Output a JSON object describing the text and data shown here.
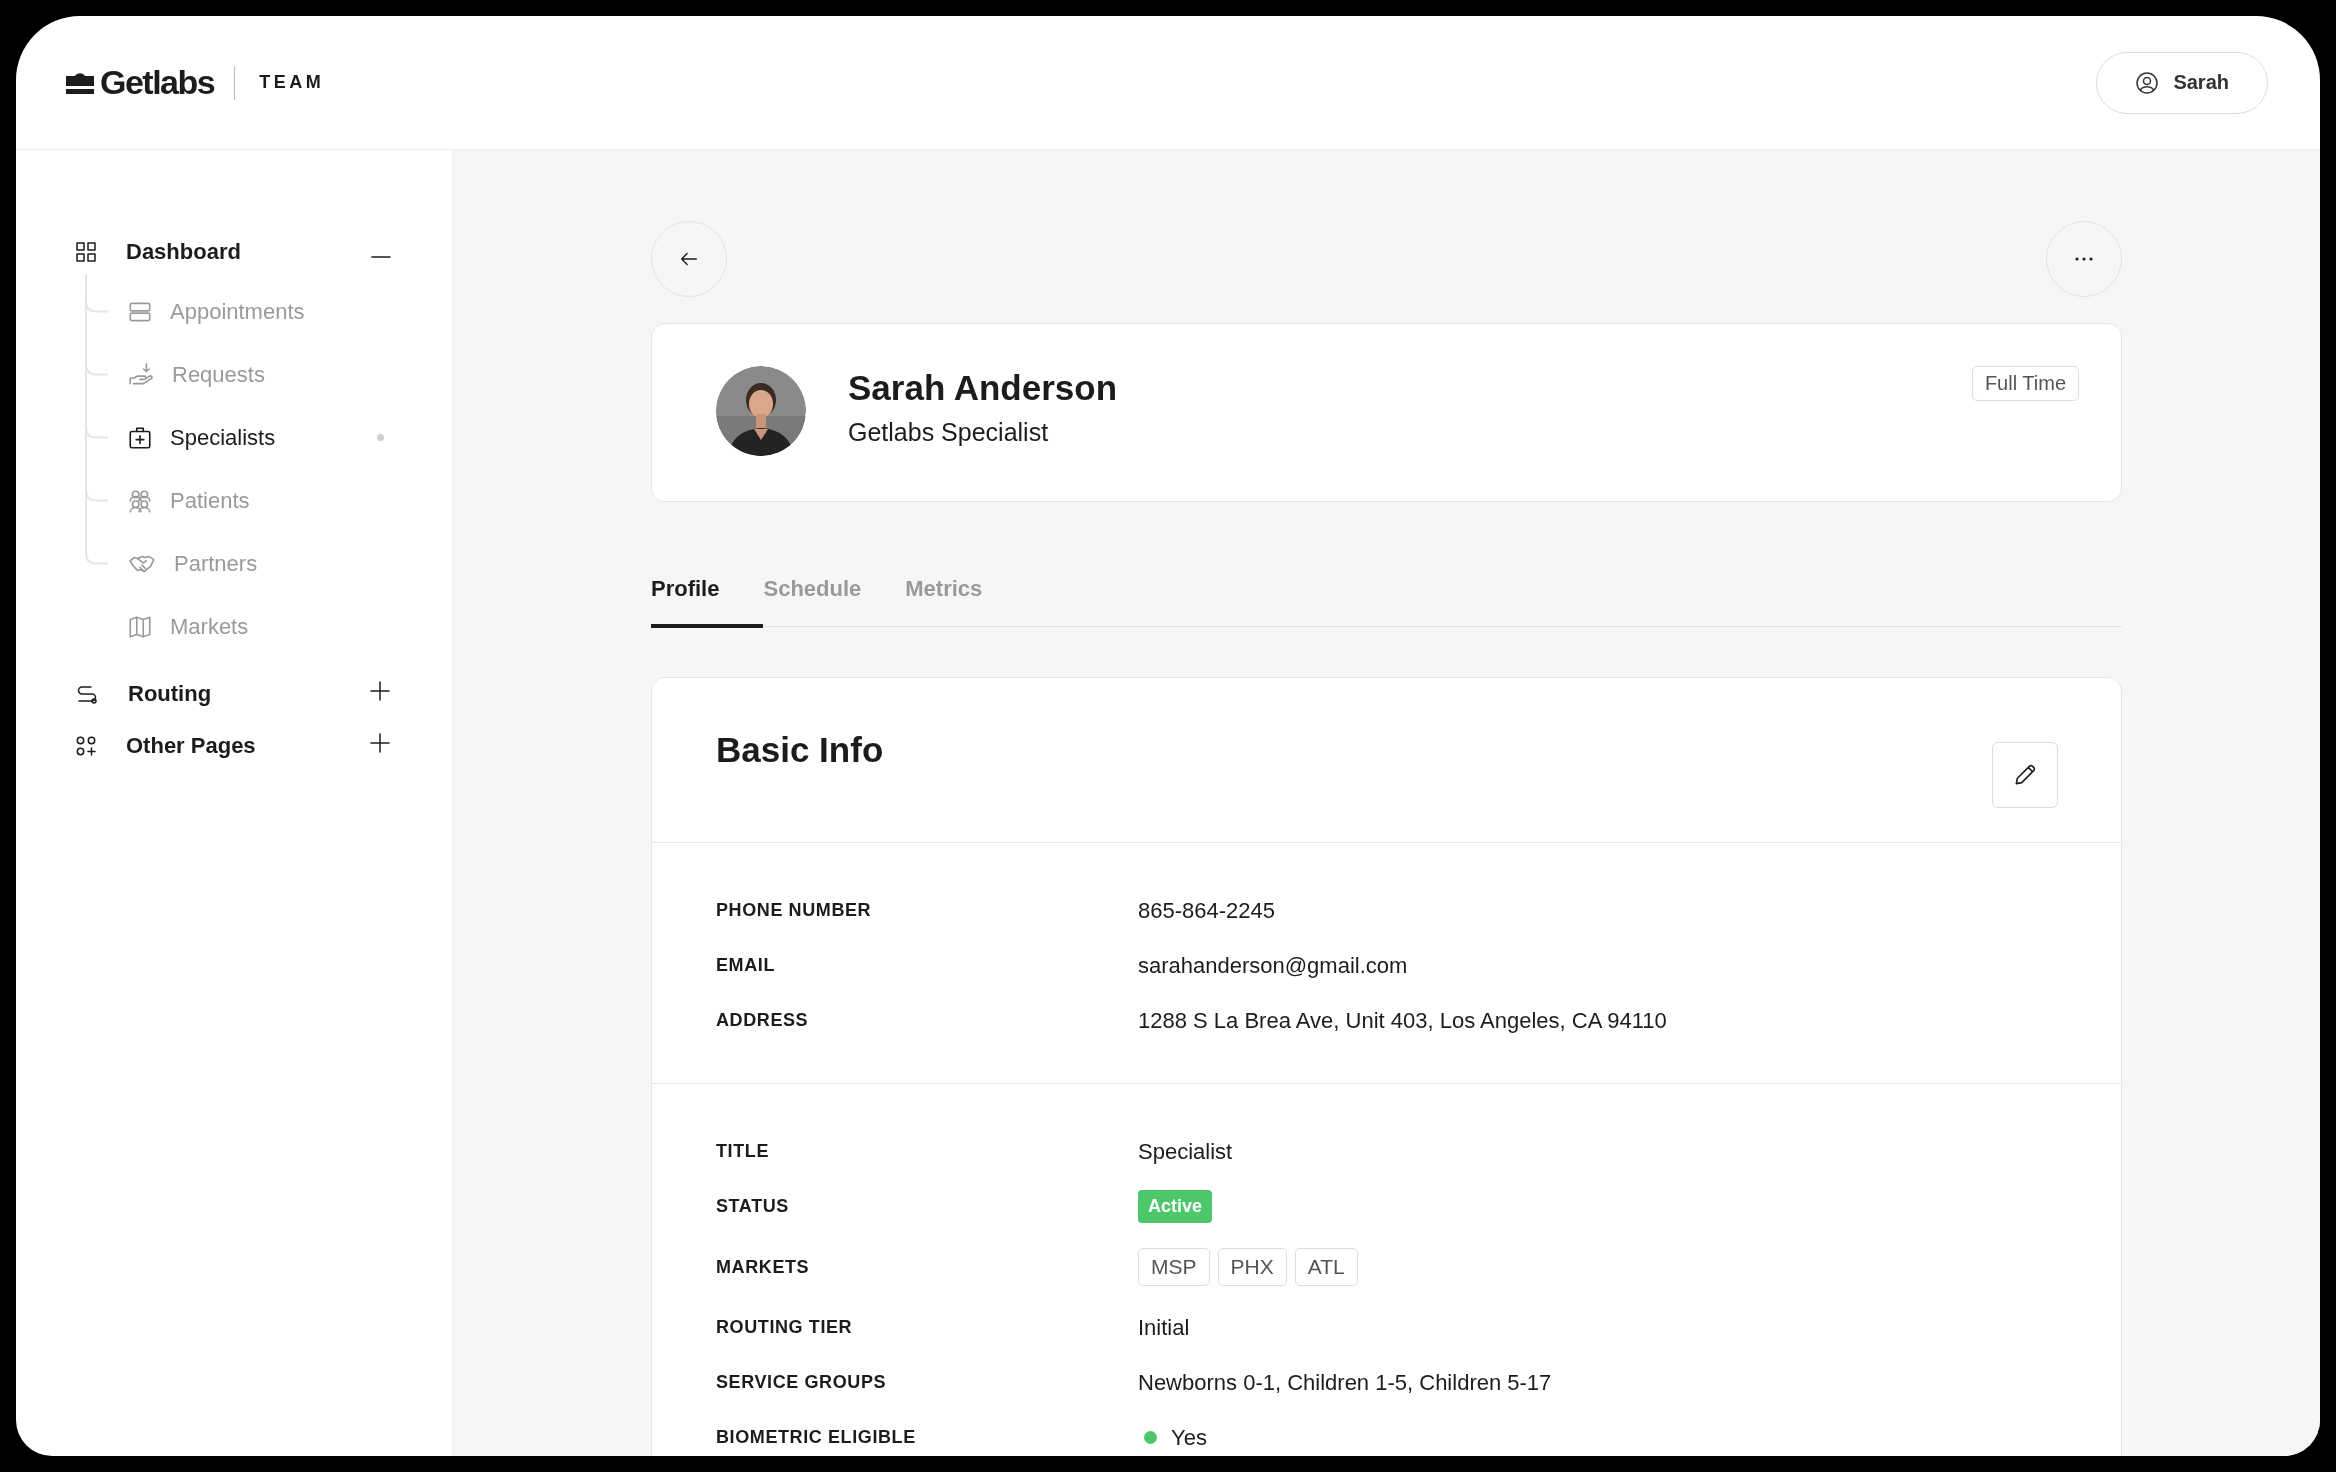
{
  "header": {
    "brand": "Getlabs",
    "product": "TEAM",
    "user": "Sarah"
  },
  "sidebar": {
    "items": [
      {
        "label": "Dashboard",
        "expanded": true,
        "children": [
          {
            "label": "Appointments",
            "selected": false
          },
          {
            "label": "Requests",
            "selected": false
          },
          {
            "label": "Specialists",
            "selected": true
          },
          {
            "label": "Patients",
            "selected": false
          },
          {
            "label": "Partners",
            "selected": false
          },
          {
            "label": "Markets",
            "selected": false
          }
        ]
      },
      {
        "label": "Routing",
        "expanded": false
      },
      {
        "label": "Other Pages",
        "expanded": false
      }
    ]
  },
  "profile": {
    "name": "Sarah Anderson",
    "role": "Getlabs Specialist",
    "badge": "Full Time"
  },
  "tabs": [
    {
      "label": "Profile",
      "selected": true
    },
    {
      "label": "Schedule",
      "selected": false
    },
    {
      "label": "Metrics",
      "selected": false
    }
  ],
  "basic_info": {
    "title": "Basic Info",
    "sections": [
      {
        "rows": [
          {
            "label": "PHONE NUMBER",
            "kind": "text",
            "value": "865-864-2245"
          },
          {
            "label": "EMAIL",
            "kind": "text",
            "value": "sarahanderson@gmail.com"
          },
          {
            "label": "ADDRESS",
            "kind": "text",
            "value": "1288 S La Brea Ave, Unit 403, Los Angeles, CA 94110"
          }
        ]
      },
      {
        "rows": [
          {
            "label": "TITLE",
            "kind": "text",
            "value": "Specialist"
          },
          {
            "label": "STATUS",
            "kind": "badge",
            "value": "Active",
            "color": "#4cc86b"
          },
          {
            "label": "MARKETS",
            "kind": "tags",
            "tags": [
              "MSP",
              "PHX",
              "ATL"
            ]
          },
          {
            "label": "ROUTING TIER",
            "kind": "text",
            "value": "Initial"
          },
          {
            "label": "SERVICE GROUPS",
            "kind": "text",
            "value": "Newborns 0-1, Children 1-5, Children 5-17"
          },
          {
            "label": "BIOMETRIC ELIGIBLE",
            "kind": "indicator",
            "value": "Yes",
            "color": "#4cc86b"
          }
        ]
      }
    ]
  }
}
